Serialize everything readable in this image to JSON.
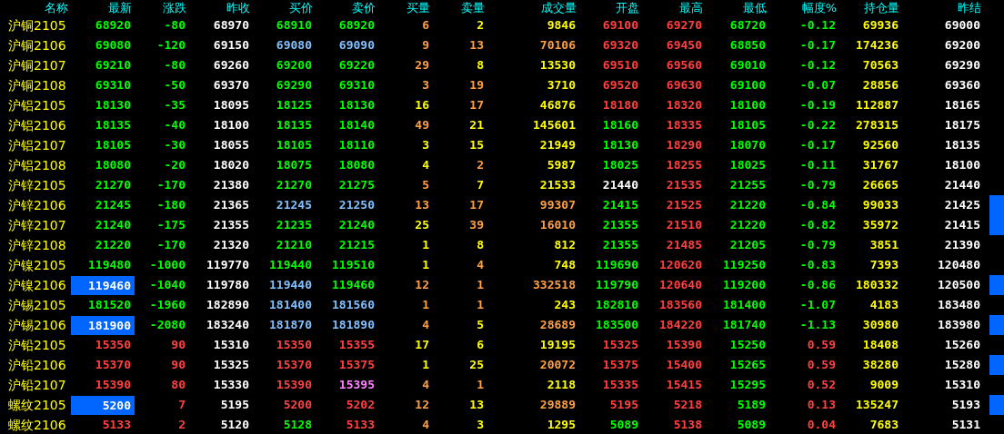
{
  "columns": [
    "名称",
    "最新",
    "涨跌",
    "昨收",
    "买价",
    "卖价",
    "买量",
    "卖量",
    "成交量",
    "开盘",
    "最高",
    "最低",
    "幅度%",
    "持仓量",
    "昨结"
  ],
  "rows": [
    {
      "name": "沪铜2105",
      "highlighted": false,
      "marked": false,
      "cells": [
        {
          "text": "68920",
          "color": "#00ff00"
        },
        {
          "text": "-80",
          "color": "#00ff00"
        },
        {
          "text": "68970",
          "color": "#ffffff"
        },
        {
          "text": "68910",
          "color": "#00ff00"
        },
        {
          "text": "68920",
          "color": "#00ff00"
        },
        {
          "text": "6",
          "color": "#ff9f40"
        },
        {
          "text": "2",
          "color": "#ffff00"
        },
        {
          "text": "9846",
          "color": "#ffff00"
        },
        {
          "text": "69100",
          "color": "#ff4040"
        },
        {
          "text": "69270",
          "color": "#ff4040"
        },
        {
          "text": "68720",
          "color": "#00ff00"
        },
        {
          "text": "-0.12",
          "color": "#00ff00"
        },
        {
          "text": "69936",
          "color": "#ffff00"
        },
        {
          "text": "69000",
          "color": "#ffffff"
        }
      ]
    },
    {
      "name": "沪铜2106",
      "highlighted": false,
      "marked": false,
      "cells": [
        {
          "text": "69080",
          "color": "#00ff00"
        },
        {
          "text": "-120",
          "color": "#00ff00"
        },
        {
          "text": "69150",
          "color": "#ffffff"
        },
        {
          "text": "69080",
          "color": "#80c0ff"
        },
        {
          "text": "69090",
          "color": "#80c0ff"
        },
        {
          "text": "9",
          "color": "#ff9f40"
        },
        {
          "text": "13",
          "color": "#ff9f40"
        },
        {
          "text": "70106",
          "color": "#ff9f40"
        },
        {
          "text": "69320",
          "color": "#ff4040"
        },
        {
          "text": "69450",
          "color": "#ff4040"
        },
        {
          "text": "68850",
          "color": "#00ff00"
        },
        {
          "text": "-0.17",
          "color": "#00ff00"
        },
        {
          "text": "174236",
          "color": "#ffff00"
        },
        {
          "text": "69200",
          "color": "#ffffff"
        }
      ]
    },
    {
      "name": "沪铜2107",
      "highlighted": false,
      "marked": false,
      "cells": [
        {
          "text": "69210",
          "color": "#00ff00"
        },
        {
          "text": "-80",
          "color": "#00ff00"
        },
        {
          "text": "69260",
          "color": "#ffffff"
        },
        {
          "text": "69200",
          "color": "#00ff00"
        },
        {
          "text": "69220",
          "color": "#00ff00"
        },
        {
          "text": "29",
          "color": "#ff9f40"
        },
        {
          "text": "8",
          "color": "#ffff00"
        },
        {
          "text": "13530",
          "color": "#ffff00"
        },
        {
          "text": "69510",
          "color": "#ff4040"
        },
        {
          "text": "69560",
          "color": "#ff4040"
        },
        {
          "text": "69010",
          "color": "#00ff00"
        },
        {
          "text": "-0.12",
          "color": "#00ff00"
        },
        {
          "text": "70563",
          "color": "#ffff00"
        },
        {
          "text": "69290",
          "color": "#ffffff"
        }
      ]
    },
    {
      "name": "沪铜2108",
      "highlighted": false,
      "marked": false,
      "cells": [
        {
          "text": "69310",
          "color": "#00ff00"
        },
        {
          "text": "-50",
          "color": "#00ff00"
        },
        {
          "text": "69370",
          "color": "#ffffff"
        },
        {
          "text": "69290",
          "color": "#00ff00"
        },
        {
          "text": "69310",
          "color": "#00ff00"
        },
        {
          "text": "3",
          "color": "#ff9f40"
        },
        {
          "text": "19",
          "color": "#ff9f40"
        },
        {
          "text": "3710",
          "color": "#ffff00"
        },
        {
          "text": "69520",
          "color": "#ff4040"
        },
        {
          "text": "69630",
          "color": "#ff4040"
        },
        {
          "text": "69100",
          "color": "#00ff00"
        },
        {
          "text": "-0.07",
          "color": "#00ff00"
        },
        {
          "text": "28856",
          "color": "#ffff00"
        },
        {
          "text": "69360",
          "color": "#ffffff"
        }
      ]
    },
    {
      "name": "沪铝2105",
      "highlighted": false,
      "marked": false,
      "cells": [
        {
          "text": "18130",
          "color": "#00ff00"
        },
        {
          "text": "-35",
          "color": "#00ff00"
        },
        {
          "text": "18095",
          "color": "#ffffff"
        },
        {
          "text": "18125",
          "color": "#00ff00"
        },
        {
          "text": "18130",
          "color": "#00ff00"
        },
        {
          "text": "16",
          "color": "#ffff00"
        },
        {
          "text": "17",
          "color": "#ff9f40"
        },
        {
          "text": "46876",
          "color": "#ffff00"
        },
        {
          "text": "18180",
          "color": "#ff4040"
        },
        {
          "text": "18320",
          "color": "#ff4040"
        },
        {
          "text": "18100",
          "color": "#00ff00"
        },
        {
          "text": "-0.19",
          "color": "#00ff00"
        },
        {
          "text": "112887",
          "color": "#ffff00"
        },
        {
          "text": "18165",
          "color": "#ffffff"
        }
      ]
    },
    {
      "name": "沪铝2106",
      "highlighted": false,
      "marked": false,
      "cells": [
        {
          "text": "18135",
          "color": "#00ff00"
        },
        {
          "text": "-40",
          "color": "#00ff00"
        },
        {
          "text": "18100",
          "color": "#ffffff"
        },
        {
          "text": "18135",
          "color": "#00ff00"
        },
        {
          "text": "18140",
          "color": "#00ff00"
        },
        {
          "text": "49",
          "color": "#ff9f40"
        },
        {
          "text": "21",
          "color": "#ffff00"
        },
        {
          "text": "145601",
          "color": "#ffff00"
        },
        {
          "text": "18160",
          "color": "#00ff00"
        },
        {
          "text": "18335",
          "color": "#ff4040"
        },
        {
          "text": "18105",
          "color": "#00ff00"
        },
        {
          "text": "-0.22",
          "color": "#00ff00"
        },
        {
          "text": "278315",
          "color": "#ffff00"
        },
        {
          "text": "18175",
          "color": "#ffffff"
        }
      ]
    },
    {
      "name": "沪铝2107",
      "highlighted": false,
      "marked": false,
      "cells": [
        {
          "text": "18105",
          "color": "#00ff00"
        },
        {
          "text": "-30",
          "color": "#00ff00"
        },
        {
          "text": "18055",
          "color": "#ffffff"
        },
        {
          "text": "18105",
          "color": "#00ff00"
        },
        {
          "text": "18110",
          "color": "#00ff00"
        },
        {
          "text": "3",
          "color": "#ffff00"
        },
        {
          "text": "15",
          "color": "#ffff00"
        },
        {
          "text": "21949",
          "color": "#ffff00"
        },
        {
          "text": "18130",
          "color": "#00ff00"
        },
        {
          "text": "18290",
          "color": "#ff4040"
        },
        {
          "text": "18070",
          "color": "#00ff00"
        },
        {
          "text": "-0.17",
          "color": "#00ff00"
        },
        {
          "text": "92560",
          "color": "#ffff00"
        },
        {
          "text": "18135",
          "color": "#ffffff"
        }
      ]
    },
    {
      "name": "沪铝2108",
      "highlighted": false,
      "marked": false,
      "cells": [
        {
          "text": "18080",
          "color": "#00ff00"
        },
        {
          "text": "-20",
          "color": "#00ff00"
        },
        {
          "text": "18020",
          "color": "#ffffff"
        },
        {
          "text": "18075",
          "color": "#00ff00"
        },
        {
          "text": "18080",
          "color": "#00ff00"
        },
        {
          "text": "4",
          "color": "#ffff00"
        },
        {
          "text": "2",
          "color": "#ff9f40"
        },
        {
          "text": "5987",
          "color": "#ffff00"
        },
        {
          "text": "18025",
          "color": "#00ff00"
        },
        {
          "text": "18255",
          "color": "#ff4040"
        },
        {
          "text": "18025",
          "color": "#00ff00"
        },
        {
          "text": "-0.11",
          "color": "#00ff00"
        },
        {
          "text": "31767",
          "color": "#ffff00"
        },
        {
          "text": "18100",
          "color": "#ffffff"
        }
      ]
    },
    {
      "name": "沪锌2105",
      "highlighted": false,
      "marked": false,
      "cells": [
        {
          "text": "21270",
          "color": "#00ff00"
        },
        {
          "text": "-170",
          "color": "#00ff00"
        },
        {
          "text": "21380",
          "color": "#ffffff"
        },
        {
          "text": "21270",
          "color": "#00ff00"
        },
        {
          "text": "21275",
          "color": "#00ff00"
        },
        {
          "text": "5",
          "color": "#ff9f40"
        },
        {
          "text": "7",
          "color": "#ffff00"
        },
        {
          "text": "21533",
          "color": "#ffff00"
        },
        {
          "text": "21440",
          "color": "#ffffff"
        },
        {
          "text": "21535",
          "color": "#ff4040"
        },
        {
          "text": "21255",
          "color": "#00ff00"
        },
        {
          "text": "-0.79",
          "color": "#00ff00"
        },
        {
          "text": "26665",
          "color": "#ffff00"
        },
        {
          "text": "21440",
          "color": "#ffffff"
        }
      ]
    },
    {
      "name": "沪锌2106",
      "highlighted": false,
      "marked": true,
      "cells": [
        {
          "text": "21245",
          "color": "#00ff00"
        },
        {
          "text": "-180",
          "color": "#00ff00"
        },
        {
          "text": "21365",
          "color": "#ffffff"
        },
        {
          "text": "21245",
          "color": "#80c0ff"
        },
        {
          "text": "21250",
          "color": "#80c0ff"
        },
        {
          "text": "13",
          "color": "#ff9f40"
        },
        {
          "text": "17",
          "color": "#ff9f40"
        },
        {
          "text": "99307",
          "color": "#ff9f40"
        },
        {
          "text": "21415",
          "color": "#00ff00"
        },
        {
          "text": "21525",
          "color": "#ff4040"
        },
        {
          "text": "21220",
          "color": "#00ff00"
        },
        {
          "text": "-0.84",
          "color": "#00ff00"
        },
        {
          "text": "99033",
          "color": "#ffff00"
        },
        {
          "text": "21425",
          "color": "#ffffff"
        }
      ]
    },
    {
      "name": "沪锌2107",
      "highlighted": false,
      "marked": true,
      "cells": [
        {
          "text": "21240",
          "color": "#00ff00"
        },
        {
          "text": "-175",
          "color": "#00ff00"
        },
        {
          "text": "21355",
          "color": "#ffffff"
        },
        {
          "text": "21235",
          "color": "#00ff00"
        },
        {
          "text": "21240",
          "color": "#00ff00"
        },
        {
          "text": "25",
          "color": "#ffff00"
        },
        {
          "text": "39",
          "color": "#ff9f40"
        },
        {
          "text": "16010",
          "color": "#ff9f40"
        },
        {
          "text": "21355",
          "color": "#00ff00"
        },
        {
          "text": "21510",
          "color": "#ff4040"
        },
        {
          "text": "21220",
          "color": "#00ff00"
        },
        {
          "text": "-0.82",
          "color": "#00ff00"
        },
        {
          "text": "35972",
          "color": "#ffff00"
        },
        {
          "text": "21415",
          "color": "#ffffff"
        }
      ]
    },
    {
      "name": "沪锌2108",
      "highlighted": false,
      "marked": false,
      "cells": [
        {
          "text": "21220",
          "color": "#00ff00"
        },
        {
          "text": "-170",
          "color": "#00ff00"
        },
        {
          "text": "21320",
          "color": "#ffffff"
        },
        {
          "text": "21210",
          "color": "#00ff00"
        },
        {
          "text": "21215",
          "color": "#00ff00"
        },
        {
          "text": "1",
          "color": "#ffff00"
        },
        {
          "text": "8",
          "color": "#ffff00"
        },
        {
          "text": "812",
          "color": "#ffff00"
        },
        {
          "text": "21355",
          "color": "#00ff00"
        },
        {
          "text": "21485",
          "color": "#ff4040"
        },
        {
          "text": "21205",
          "color": "#00ff00"
        },
        {
          "text": "-0.79",
          "color": "#00ff00"
        },
        {
          "text": "3851",
          "color": "#ffff00"
        },
        {
          "text": "21390",
          "color": "#ffffff"
        }
      ]
    },
    {
      "name": "沪镍2105",
      "highlighted": false,
      "marked": false,
      "cells": [
        {
          "text": "119480",
          "color": "#00ff00"
        },
        {
          "text": "-1000",
          "color": "#00ff00"
        },
        {
          "text": "119770",
          "color": "#ffffff"
        },
        {
          "text": "119440",
          "color": "#00ff00"
        },
        {
          "text": "119510",
          "color": "#00ff00"
        },
        {
          "text": "1",
          "color": "#ffff00"
        },
        {
          "text": "4",
          "color": "#ff9f40"
        },
        {
          "text": "748",
          "color": "#ffff00"
        },
        {
          "text": "119690",
          "color": "#00ff00"
        },
        {
          "text": "120620",
          "color": "#ff4040"
        },
        {
          "text": "119250",
          "color": "#00ff00"
        },
        {
          "text": "-0.83",
          "color": "#00ff00"
        },
        {
          "text": "7393",
          "color": "#ffff00"
        },
        {
          "text": "120480",
          "color": "#ffffff"
        }
      ]
    },
    {
      "name": "沪镍2106",
      "highlighted": true,
      "marked": true,
      "cells": [
        {
          "text": "119460",
          "color": "#ffffff"
        },
        {
          "text": "-1040",
          "color": "#00ff00"
        },
        {
          "text": "119780",
          "color": "#ffffff"
        },
        {
          "text": "119440",
          "color": "#80c0ff"
        },
        {
          "text": "119460",
          "color": "#00ff00"
        },
        {
          "text": "12",
          "color": "#ff9f40"
        },
        {
          "text": "1",
          "color": "#ff9f40"
        },
        {
          "text": "332518",
          "color": "#ff9f40"
        },
        {
          "text": "119790",
          "color": "#00ff00"
        },
        {
          "text": "120640",
          "color": "#ff4040"
        },
        {
          "text": "119200",
          "color": "#00ff00"
        },
        {
          "text": "-0.86",
          "color": "#00ff00"
        },
        {
          "text": "180332",
          "color": "#ffff00"
        },
        {
          "text": "120500",
          "color": "#ffffff"
        }
      ]
    },
    {
      "name": "沪锡2105",
      "highlighted": false,
      "marked": false,
      "cells": [
        {
          "text": "181520",
          "color": "#00ff00"
        },
        {
          "text": "-1960",
          "color": "#00ff00"
        },
        {
          "text": "182890",
          "color": "#ffffff"
        },
        {
          "text": "181400",
          "color": "#80c0ff"
        },
        {
          "text": "181560",
          "color": "#80c0ff"
        },
        {
          "text": "1",
          "color": "#ff9f40"
        },
        {
          "text": "1",
          "color": "#ff9f40"
        },
        {
          "text": "243",
          "color": "#ffff00"
        },
        {
          "text": "182810",
          "color": "#00ff00"
        },
        {
          "text": "183560",
          "color": "#ff4040"
        },
        {
          "text": "181400",
          "color": "#00ff00"
        },
        {
          "text": "-1.07",
          "color": "#00ff00"
        },
        {
          "text": "4183",
          "color": "#ffff00"
        },
        {
          "text": "183480",
          "color": "#ffffff"
        }
      ]
    },
    {
      "name": "沪锡2106",
      "highlighted": true,
      "marked": true,
      "cells": [
        {
          "text": "181900",
          "color": "#ffffff"
        },
        {
          "text": "-2080",
          "color": "#00ff00"
        },
        {
          "text": "183240",
          "color": "#ffffff"
        },
        {
          "text": "181870",
          "color": "#80c0ff"
        },
        {
          "text": "181890",
          "color": "#80c0ff"
        },
        {
          "text": "4",
          "color": "#ff9f40"
        },
        {
          "text": "5",
          "color": "#ffff00"
        },
        {
          "text": "28689",
          "color": "#ff9f40"
        },
        {
          "text": "183500",
          "color": "#00ff00"
        },
        {
          "text": "184220",
          "color": "#ff4040"
        },
        {
          "text": "181740",
          "color": "#00ff00"
        },
        {
          "text": "-1.13",
          "color": "#00ff00"
        },
        {
          "text": "30980",
          "color": "#ffff00"
        },
        {
          "text": "183980",
          "color": "#ffffff"
        }
      ]
    },
    {
      "name": "沪铅2105",
      "highlighted": false,
      "marked": false,
      "cells": [
        {
          "text": "15350",
          "color": "#ff4040"
        },
        {
          "text": "90",
          "color": "#ff4040"
        },
        {
          "text": "15310",
          "color": "#ffffff"
        },
        {
          "text": "15350",
          "color": "#ff4040"
        },
        {
          "text": "15355",
          "color": "#ff4040"
        },
        {
          "text": "17",
          "color": "#ffff00"
        },
        {
          "text": "6",
          "color": "#ffff00"
        },
        {
          "text": "19195",
          "color": "#ffff00"
        },
        {
          "text": "15325",
          "color": "#ff4040"
        },
        {
          "text": "15390",
          "color": "#ff4040"
        },
        {
          "text": "15250",
          "color": "#00ff00"
        },
        {
          "text": "0.59",
          "color": "#ff4040"
        },
        {
          "text": "18408",
          "color": "#ffff00"
        },
        {
          "text": "15260",
          "color": "#ffffff"
        }
      ]
    },
    {
      "name": "沪铅2106",
      "highlighted": false,
      "marked": true,
      "cells": [
        {
          "text": "15370",
          "color": "#ff4040"
        },
        {
          "text": "90",
          "color": "#ff4040"
        },
        {
          "text": "15325",
          "color": "#ffffff"
        },
        {
          "text": "15370",
          "color": "#ff4040"
        },
        {
          "text": "15375",
          "color": "#ff4040"
        },
        {
          "text": "1",
          "color": "#ffff00"
        },
        {
          "text": "25",
          "color": "#ffff00"
        },
        {
          "text": "20072",
          "color": "#ff9f40"
        },
        {
          "text": "15375",
          "color": "#ff4040"
        },
        {
          "text": "15400",
          "color": "#ff4040"
        },
        {
          "text": "15265",
          "color": "#00ff00"
        },
        {
          "text": "0.59",
          "color": "#ff4040"
        },
        {
          "text": "38280",
          "color": "#ffff00"
        },
        {
          "text": "15280",
          "color": "#ffffff"
        }
      ]
    },
    {
      "name": "沪铅2107",
      "highlighted": false,
      "marked": false,
      "cells": [
        {
          "text": "15390",
          "color": "#ff4040"
        },
        {
          "text": "80",
          "color": "#ff4040"
        },
        {
          "text": "15330",
          "color": "#ffffff"
        },
        {
          "text": "15390",
          "color": "#ff4040"
        },
        {
          "text": "15395",
          "color": "#ff80ff"
        },
        {
          "text": "4",
          "color": "#ff9f40"
        },
        {
          "text": "1",
          "color": "#ff9f40"
        },
        {
          "text": "2118",
          "color": "#ffff00"
        },
        {
          "text": "15335",
          "color": "#ff4040"
        },
        {
          "text": "15415",
          "color": "#ff4040"
        },
        {
          "text": "15295",
          "color": "#00ff00"
        },
        {
          "text": "0.52",
          "color": "#ff4040"
        },
        {
          "text": "9009",
          "color": "#ffff00"
        },
        {
          "text": "15310",
          "color": "#ffffff"
        }
      ]
    },
    {
      "name": "螺纹2105",
      "highlighted": true,
      "marked": true,
      "cells": [
        {
          "text": "5200",
          "color": "#ffffff"
        },
        {
          "text": "7",
          "color": "#ff4040"
        },
        {
          "text": "5195",
          "color": "#ffffff"
        },
        {
          "text": "5200",
          "color": "#ff4040"
        },
        {
          "text": "5202",
          "color": "#ff4040"
        },
        {
          "text": "12",
          "color": "#ff9f40"
        },
        {
          "text": "13",
          "color": "#ffff00"
        },
        {
          "text": "29889",
          "color": "#ff9f40"
        },
        {
          "text": "5195",
          "color": "#ff4040"
        },
        {
          "text": "5218",
          "color": "#ff4040"
        },
        {
          "text": "5189",
          "color": "#00ff00"
        },
        {
          "text": "0.13",
          "color": "#ff4040"
        },
        {
          "text": "135247",
          "color": "#ffff00"
        },
        {
          "text": "5193",
          "color": "#ffffff"
        }
      ]
    },
    {
      "name": "螺纹2106",
      "highlighted": false,
      "marked": false,
      "cells": [
        {
          "text": "5133",
          "color": "#ff4040"
        },
        {
          "text": "2",
          "color": "#ff4040"
        },
        {
          "text": "5120",
          "color": "#ffffff"
        },
        {
          "text": "5128",
          "color": "#00ff00"
        },
        {
          "text": "5133",
          "color": "#ff4040"
        },
        {
          "text": "4",
          "color": "#ff9f40"
        },
        {
          "text": "3",
          "color": "#ffff00"
        },
        {
          "text": "1295",
          "color": "#ffff00"
        },
        {
          "text": "5089",
          "color": "#00ff00"
        },
        {
          "text": "5138",
          "color": "#ff4040"
        },
        {
          "text": "5089",
          "color": "#00ff00"
        },
        {
          "text": "0.04",
          "color": "#ff4040"
        },
        {
          "text": "7683",
          "color": "#ffff00"
        },
        {
          "text": "5131",
          "color": "#ffffff"
        }
      ]
    }
  ]
}
